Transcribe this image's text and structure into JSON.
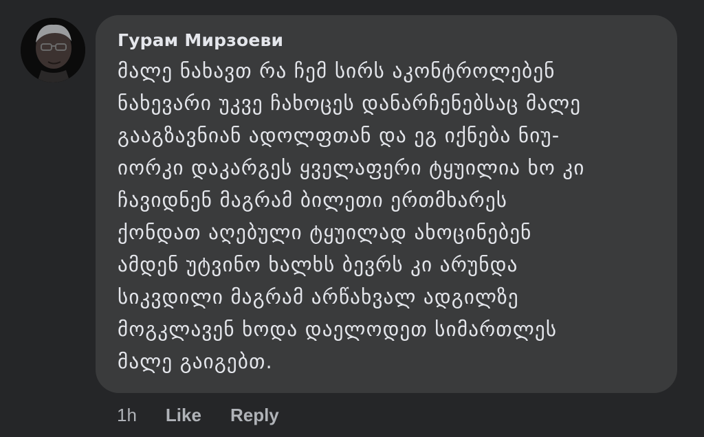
{
  "comment": {
    "author": "Гурам Мирзоеви",
    "avatar_icon": "profile-photo",
    "text_lines": [
      "მალე ნახავთ რა ჩემ სირს აკონტროლებენ",
      "ნახევარი უკვე ჩახოცეს დანარჩენებსაც მალე",
      "გააგზავნიან ადოლფთან და ეგ იქნება ნიუ-",
      "იორკი დაკარგეს ყველაფერი ტყუილია ხო კი",
      "ჩავიდნენ მაგრამ ბილეთი ერთმხარეს",
      "ქონდათ აღებული ტყუილად ახოცინებენ",
      "ამდენ უტვინო ხალხს ბევრს კი არუნდა",
      "სიკვდილი მაგრამ არწახვალ ადგილზე",
      "მოგკლავენ ხოდა დაელოდეთ სიმართლეს",
      "მალე გაიგებთ."
    ]
  },
  "actions": {
    "time": "1h",
    "like_label": "Like",
    "reply_label": "Reply"
  },
  "colors": {
    "background": "#252628",
    "bubble": "#3a3b3c",
    "text": "#e4e6eb",
    "secondary_text": "#b0b3b8"
  }
}
